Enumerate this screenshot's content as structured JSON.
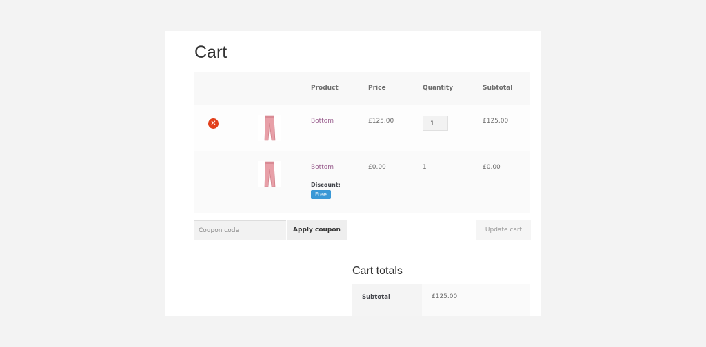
{
  "page": {
    "title": "Cart"
  },
  "table": {
    "headers": {
      "product": "Product",
      "price": "Price",
      "quantity": "Quantity",
      "subtotal": "Subtotal"
    },
    "rows": [
      {
        "product": "Bottom",
        "price": "£125.00",
        "quantity": "1",
        "subtotal": "£125.00",
        "removable": true
      },
      {
        "product": "Bottom",
        "price": "£0.00",
        "quantity": "1",
        "subtotal": "£0.00",
        "discount_label": "Discount:",
        "discount_badge": "Free"
      }
    ]
  },
  "actions": {
    "coupon_placeholder": "Coupon code",
    "apply_coupon": "Apply coupon",
    "update_cart": "Update cart"
  },
  "totals": {
    "title": "Cart totals",
    "subtotal_label": "Subtotal",
    "subtotal_value": "£125.00"
  },
  "colors": {
    "accent_link": "#96588a",
    "remove_icon": "#e2401c",
    "badge": "#3a98d6"
  },
  "icons": {
    "remove": "remove-circle-icon",
    "product_thumb": "pants-thumbnail"
  }
}
